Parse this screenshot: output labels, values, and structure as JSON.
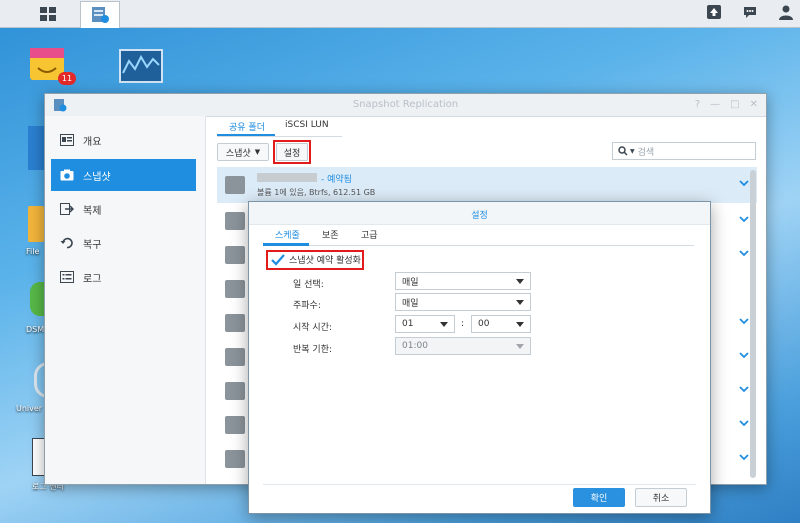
{
  "window": {
    "title": "Snapshot Replication"
  },
  "sidebar": {
    "items": [
      {
        "label": "개요",
        "icon": "overview-icon"
      },
      {
        "label": "스냅샷",
        "icon": "camera-icon"
      },
      {
        "label": "복제",
        "icon": "replicate-icon"
      },
      {
        "label": "복구",
        "icon": "restore-icon"
      },
      {
        "label": "로그",
        "icon": "log-icon"
      }
    ],
    "active_index": 1
  },
  "tabs": [
    {
      "label": "공유 폴더"
    },
    {
      "label": "iSCSI LUN"
    }
  ],
  "toolbar": {
    "snapshot_label": "스냅샷",
    "settings_label": "설정",
    "search_placeholder": "검색"
  },
  "rows": {
    "first": {
      "name_suffix": "- 예약됨",
      "detail": "볼륨 1에 있음, Btrfs, 612.51 GB"
    }
  },
  "desktop": {
    "badge_count": "11",
    "labels": {
      "file": "File",
      "dsm": "DSM",
      "univ": "Univer",
      "log_center": "로그 센터"
    }
  },
  "dialog": {
    "title": "설정",
    "tabs": [
      {
        "label": "스케줄"
      },
      {
        "label": "보존"
      },
      {
        "label": "고급"
      }
    ],
    "enable_label": "스냅샷 예약 활성화",
    "enabled": true,
    "fields": {
      "day_label": "일 선택:",
      "day_value": "매일",
      "freq_label": "주파수:",
      "freq_value": "매일",
      "time_label": "시작 시간:",
      "hour_value": "01",
      "min_value": "00",
      "time_sep": ":",
      "repeat_label": "반복 기한:",
      "repeat_value": "01:00"
    },
    "ok_label": "확인",
    "cancel_label": "취소"
  },
  "colors": {
    "accent": "#1f8de0",
    "highlight": "#e21b1b"
  }
}
